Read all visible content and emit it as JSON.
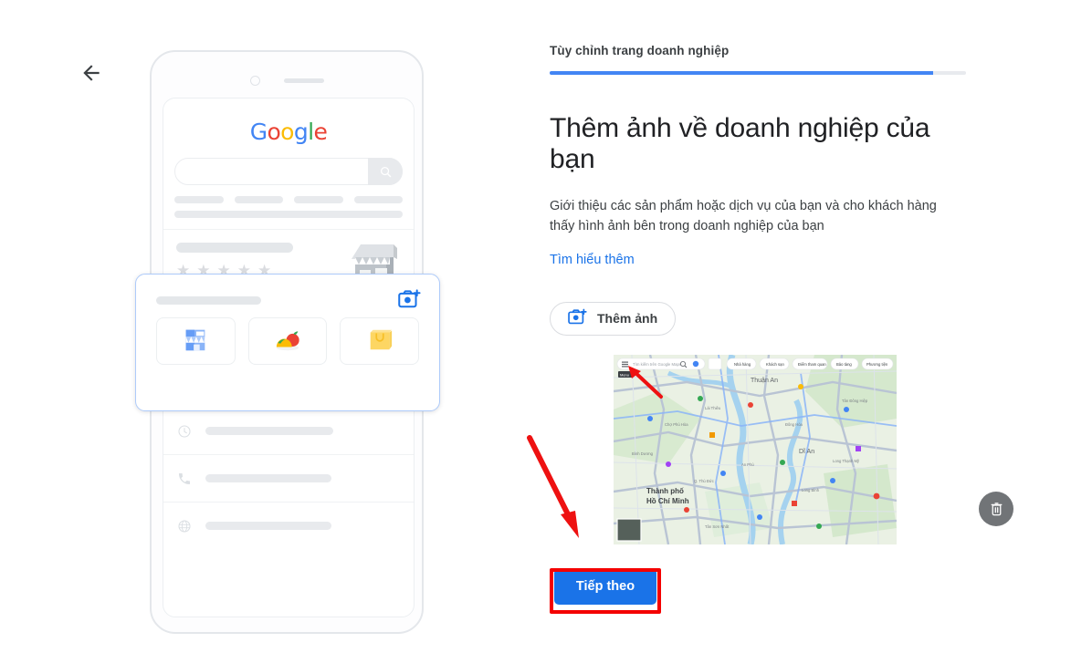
{
  "nav": {
    "back_icon": "arrow-left-icon"
  },
  "phone": {
    "google_logo": [
      "G",
      "o",
      "o",
      "g",
      "l",
      "e"
    ],
    "search_icon": "search-icon",
    "storefront_illustration": "storefront-icon",
    "highlight_card": {
      "camera_icon": "add-photo-camera-icon",
      "tiles": [
        {
          "name": "storefront-tile",
          "icon": "storefront-blue-icon"
        },
        {
          "name": "food-tile",
          "icon": "food-icon"
        },
        {
          "name": "shopping-tile",
          "icon": "shopping-bag-icon"
        }
      ]
    },
    "info_rows": [
      {
        "name": "address-row",
        "icon": "location-pin-icon",
        "lines": 2,
        "has_map": true
      },
      {
        "name": "hours-row",
        "icon": "clock-icon",
        "lines": 1,
        "has_map": false
      },
      {
        "name": "phone-row",
        "icon": "phone-icon",
        "lines": 1,
        "has_map": false
      },
      {
        "name": "website-row",
        "icon": "globe-icon",
        "lines": 1,
        "has_map": false
      }
    ]
  },
  "panel": {
    "step_label": "Tùy chỉnh trang doanh nghiệp",
    "progress_percent": 92,
    "title": "Thêm ảnh về doanh nghiệp của bạn",
    "description": "Giới thiệu các sản phẩm hoặc dịch vụ của bạn và cho khách hàng thấy hình ảnh bên trong doanh nghiệp của bạn",
    "learn_more_label": "Tìm hiểu thêm",
    "add_photo_label": "Thêm ảnh",
    "add_photo_icon": "add-photo-camera-icon",
    "uploaded_photo": {
      "name": "uploaded-map-screenshot",
      "map_labels": [
        "Thuận An",
        "Dĩ An",
        "Thành phố Hồ Chí Minh"
      ],
      "alt": "Ảnh chụp màn hình Google Maps Thành phố Hồ Chí Minh"
    },
    "delete_icon": "trash-icon",
    "next_label": "Tiếp theo"
  },
  "annotations": {
    "arrow_color": "#f40000",
    "highlight_box_color": "#f40000"
  },
  "colors": {
    "accent_blue": "#1a73e8",
    "progress_blue": "#4285F4",
    "link_blue": "#1a73e8",
    "card_border": "#aecbfa"
  }
}
